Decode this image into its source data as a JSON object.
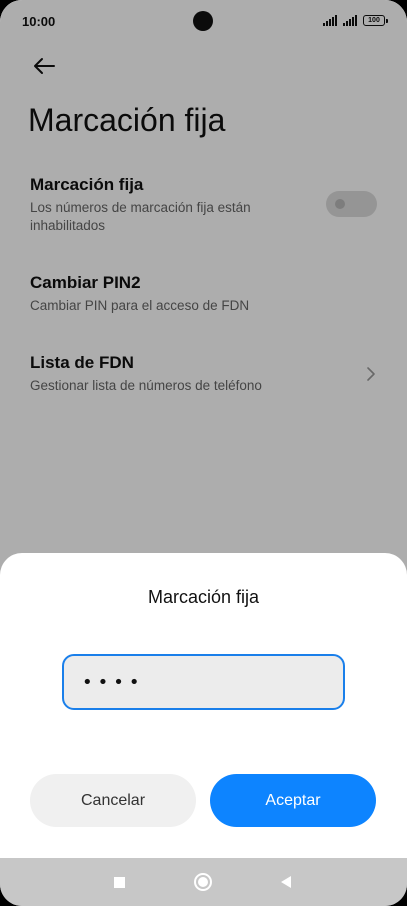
{
  "status": {
    "time": "10:00",
    "battery": "100"
  },
  "page": {
    "title": "Marcación fija"
  },
  "settings": [
    {
      "title": "Marcación fija",
      "subtitle": "Los números de marcación fija están inhabilitados",
      "toggle_on": false
    },
    {
      "title": "Cambiar PIN2",
      "subtitle": "Cambiar PIN para el acceso de FDN"
    },
    {
      "title": "Lista de FDN",
      "subtitle": "Gestionar lista de números de teléfono"
    }
  ],
  "dialog": {
    "title": "Marcación fija",
    "pin_value": "••••",
    "cancel_label": "Cancelar",
    "accept_label": "Aceptar"
  },
  "colors": {
    "accent": "#0d84ff",
    "scrim": "rgba(0,0,0,0.32)"
  },
  "icons": [
    "back-arrow-icon",
    "chevron-right-icon",
    "signal-icon",
    "battery-icon",
    "recents-icon",
    "home-icon",
    "nav-back-icon"
  ]
}
